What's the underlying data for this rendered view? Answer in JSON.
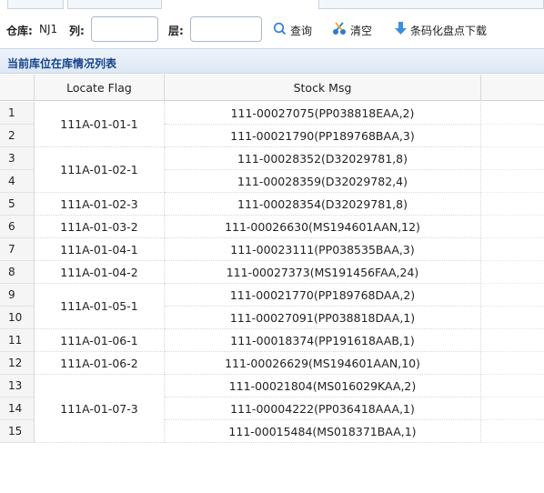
{
  "toolbar": {
    "warehouse_label": "仓库:",
    "warehouse_value": "NJ1",
    "column_label": "列:",
    "column_value": "",
    "layer_label": "层:",
    "layer_value": "",
    "query_label": "查询",
    "clear_label": "清空",
    "download_label": "条码化盘点下载"
  },
  "panel": {
    "title": "当前库位在库情况列表"
  },
  "table": {
    "columns": [
      "",
      "Locate Flag",
      "Stock Msg"
    ],
    "rows": [
      {
        "no": "1",
        "locate": "111A-01-01-1",
        "span": 2,
        "stock": "111-00027075(PP038818EAA,2)"
      },
      {
        "no": "2",
        "locate": "",
        "span": 0,
        "stock": "111-00021790(PP189768BAA,3)"
      },
      {
        "no": "3",
        "locate": "111A-01-02-1",
        "span": 2,
        "stock": "111-00028352(D32029781,8)"
      },
      {
        "no": "4",
        "locate": "",
        "span": 0,
        "stock": "111-00028359(D32029782,4)"
      },
      {
        "no": "5",
        "locate": "111A-01-02-3",
        "span": 1,
        "stock": "111-00028354(D32029781,8)"
      },
      {
        "no": "6",
        "locate": "111A-01-03-2",
        "span": 1,
        "stock": "111-00026630(MS194601AAN,12)"
      },
      {
        "no": "7",
        "locate": "111A-01-04-1",
        "span": 1,
        "stock": "111-00023111(PP038535BAA,3)"
      },
      {
        "no": "8",
        "locate": "111A-01-04-2",
        "span": 1,
        "stock": "111-00027373(MS191456FAA,24)"
      },
      {
        "no": "9",
        "locate": "111A-01-05-1",
        "span": 2,
        "stock": "111-00021770(PP189768DAA,2)"
      },
      {
        "no": "10",
        "locate": "",
        "span": 0,
        "stock": "111-00027091(PP038818DAA,1)"
      },
      {
        "no": "11",
        "locate": "111A-01-06-1",
        "span": 1,
        "stock": "111-00018374(PP191618AAB,1)"
      },
      {
        "no": "12",
        "locate": "111A-01-06-2",
        "span": 1,
        "stock": "111-00026629(MS194601AAN,10)"
      },
      {
        "no": "13",
        "locate": "111A-01-07-3",
        "span": 3,
        "stock": "111-00021804(MS016029KAA,2)"
      },
      {
        "no": "14",
        "locate": "",
        "span": 0,
        "stock": "111-00004222(PP036418AAA,1)"
      },
      {
        "no": "15",
        "locate": "",
        "span": 0,
        "stock": "111-00015484(MS018371BAA,1)"
      }
    ]
  },
  "colors": {
    "panel_title": "#15428b",
    "query_icon": "#2a7bd4",
    "clear_icon": "#2a7bd4",
    "download_icon": "#3b8fe0"
  }
}
